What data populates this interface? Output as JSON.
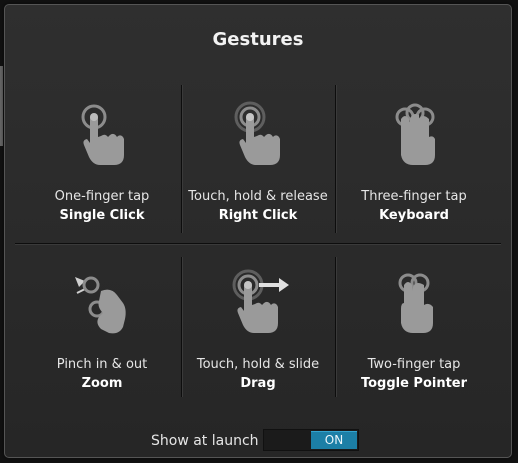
{
  "dialog": {
    "title": "Gestures"
  },
  "gestures": [
    {
      "line1": "One-finger tap",
      "line2": "Single Click",
      "icon": "one-finger-tap-icon"
    },
    {
      "line1": "Touch, hold & release",
      "line2": "Right Click",
      "icon": "touch-hold-release-icon"
    },
    {
      "line1": "Three-finger tap",
      "line2": "Keyboard",
      "icon": "three-finger-tap-icon"
    },
    {
      "line1": "Pinch in & out",
      "line2": "Zoom",
      "icon": "pinch-icon"
    },
    {
      "line1": "Touch, hold & slide",
      "line2": "Drag",
      "icon": "touch-hold-slide-icon"
    },
    {
      "line1": "Two-finger tap",
      "line2": "Toggle Pointer",
      "icon": "two-finger-tap-icon"
    }
  ],
  "footer": {
    "show_at_launch_label": "Show at launch",
    "toggle_state": "ON"
  },
  "colors": {
    "accent": "#1c7fa6",
    "background": "#2b2b2b",
    "icon": "#9a9a9a"
  }
}
